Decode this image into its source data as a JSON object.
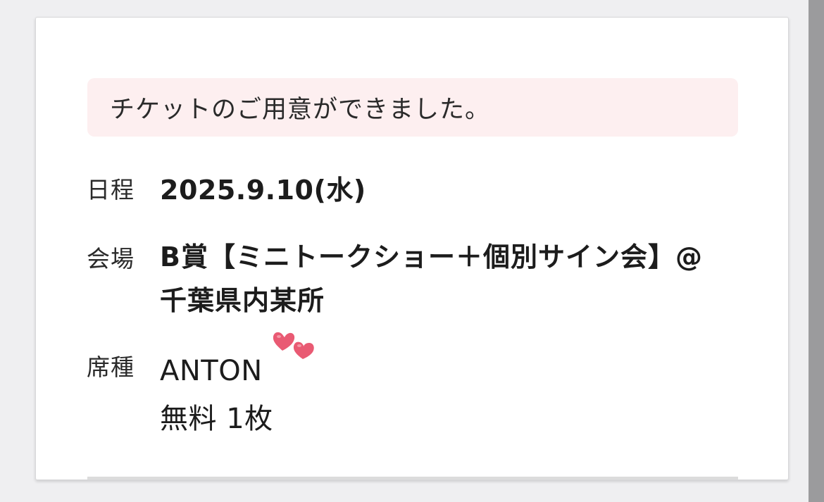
{
  "notice": {
    "message": "チケットのご用意ができました。"
  },
  "details": {
    "date": {
      "label": "日程",
      "value": "2025.9.10(水)"
    },
    "venue": {
      "label": "会場",
      "value": "B賞【ミニトークショー＋個別サイン会】@千葉県内某所"
    },
    "seat": {
      "label": "席種",
      "name": "ANTON",
      "price_qty": "無料 1枚"
    }
  },
  "decorations": {
    "hearts_icon": "two-hearts-icon",
    "heart_color": "#e95a73"
  },
  "colors": {
    "notice_background": "#fdeff0",
    "page_background": "#efeff1",
    "card_background": "#ffffff"
  }
}
